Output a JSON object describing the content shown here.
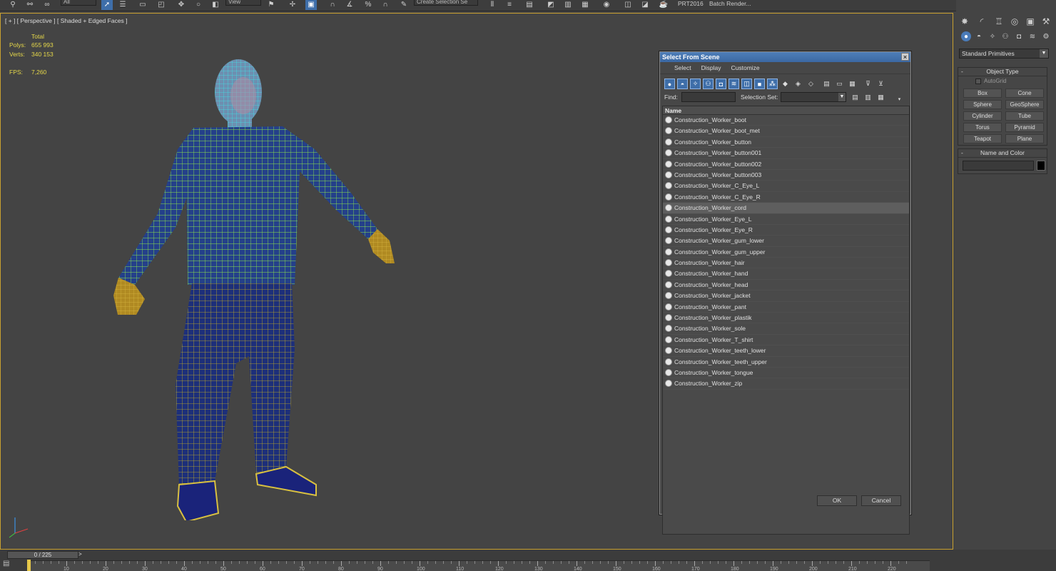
{
  "toolbar": {
    "filter_value": "All",
    "view_value": "View",
    "selection_set_placeholder": "Create Selection Se",
    "prt_label": "PRT2016",
    "batch_render_label": "Batch Render..."
  },
  "viewport": {
    "label": "[ + ] [ Perspective ] [ Shaded + Edged Faces ]",
    "stats": {
      "total_label": "Total",
      "polys_label": "Polys:",
      "polys_value": "655 993",
      "verts_label": "Verts:",
      "verts_value": "340 153",
      "fps_label": "FPS:",
      "fps_value": "7,260"
    }
  },
  "command_panel": {
    "category": "Standard Primitives",
    "object_type": {
      "title": "Object Type",
      "autogrid_label": "AutoGrid",
      "buttons": [
        "Box",
        "Cone",
        "Sphere",
        "GeoSphere",
        "Cylinder",
        "Tube",
        "Torus",
        "Pyramid",
        "Teapot",
        "Plane"
      ]
    },
    "name_color": {
      "title": "Name and Color",
      "color": "#000000"
    }
  },
  "dialog": {
    "title": "Select From Scene",
    "menu": [
      "Select",
      "Display",
      "Customize"
    ],
    "find_label": "Find:",
    "selection_set_label": "Selection Set:",
    "column_name": "Name",
    "items": [
      "Construction_Worker_boot",
      "Construction_Worker_boot_met",
      "Construction_Worker_button",
      "Construction_Worker_button001",
      "Construction_Worker_button002",
      "Construction_Worker_button003",
      "Construction_Worker_C_Eye_L",
      "Construction_Worker_C_Eye_R",
      "Construction_Worker_cord",
      "Construction_Worker_Eye_L",
      "Construction_Worker_Eye_R",
      "Construction_Worker_gum_lower",
      "Construction_Worker_gum_upper",
      "Construction_Worker_hair",
      "Construction_Worker_hand",
      "Construction_Worker_head",
      "Construction_Worker_jacket",
      "Construction_Worker_pant",
      "Construction_Worker_plastik",
      "Construction_Worker_sole",
      "Construction_Worker_T_shirt",
      "Construction_Worker_teeth_lower",
      "Construction_Worker_teeth_upper",
      "Construction_Worker_tongue",
      "Construction_Worker_zip"
    ],
    "selected_item": "Construction_Worker_cord",
    "ok_label": "OK",
    "cancel_label": "Cancel"
  },
  "timeline": {
    "frame_display": "0 / 225",
    "next_label": ">",
    "tick_labels": [
      "10",
      "20",
      "30",
      "40",
      "50",
      "60",
      "70",
      "80",
      "90",
      "100",
      "110",
      "120",
      "130",
      "140",
      "150",
      "160",
      "170",
      "180",
      "190",
      "200",
      "210",
      "220"
    ]
  },
  "colors": {
    "accent": "#3e6ea9",
    "stats": "#e6d84a",
    "viewport_border": "#c8a030"
  }
}
